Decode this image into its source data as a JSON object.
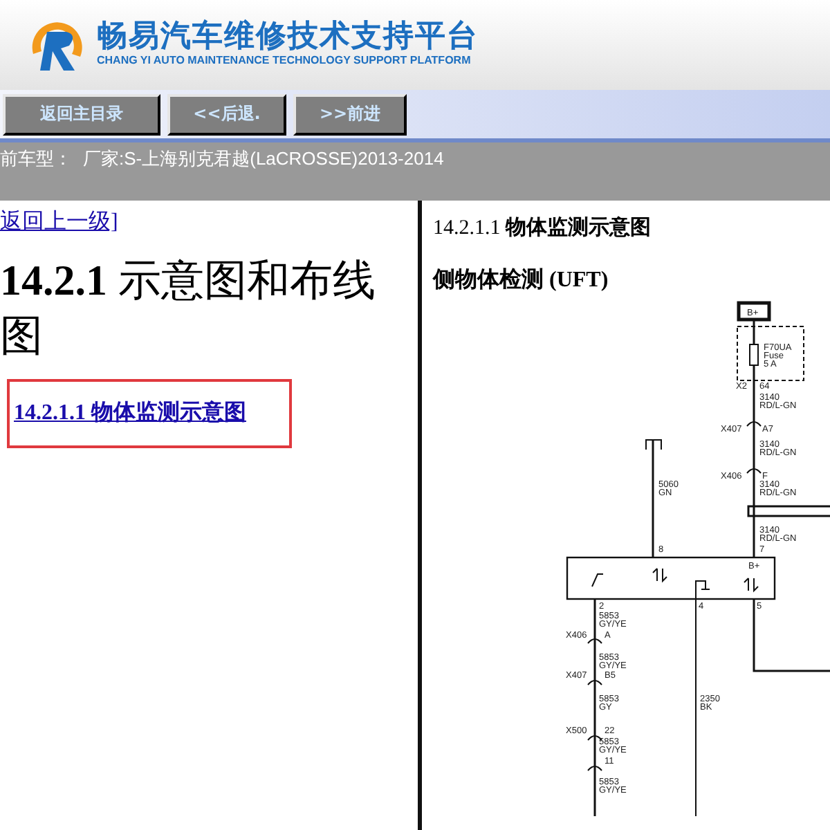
{
  "header": {
    "title": "畅易汽车维修技术支持平台",
    "subtitle": "CHANG YI AUTO MAINTENANCE TECHNOLOGY SUPPORT PLATFORM"
  },
  "nav_buttons": [
    "返回主目录",
    "<<后退.",
    ">>前进"
  ],
  "model_bar": {
    "label": "前车型：",
    "value": "厂家:S-上海别克君越(LaCROSSE)2013-2014"
  },
  "left": {
    "back_link": "返回上一级]",
    "heading_number": "14.2.1",
    "heading_text": "示意图和布线图",
    "toc_link": "14.2.1.1 物体监测示意图"
  },
  "right": {
    "section_number": "14.2.1.1",
    "section_title": "物体监测示意图",
    "subtitle": "侧物体检测 (UFT)",
    "diagram": {
      "labels": [
        "B+",
        "F70UA",
        "Fuse",
        "5 A",
        "X2",
        "64",
        "3140",
        "RD/L-GN",
        "X407",
        "A7",
        "3140",
        "RD/L-GN",
        "X406",
        "F",
        "3140",
        "RD/L-GN",
        "3140",
        "RD/L-GN",
        "7",
        "5060",
        "GN",
        "8",
        "B+",
        "2",
        "5853",
        "GY/YE",
        "X406",
        "A",
        "5853",
        "GY/YE",
        "X407",
        "B5",
        "5853",
        "GY",
        "X500",
        "22",
        "5853",
        "GY/YE",
        "11",
        "5853",
        "GY/YE",
        "4",
        "2350",
        "BK",
        "5"
      ]
    }
  }
}
